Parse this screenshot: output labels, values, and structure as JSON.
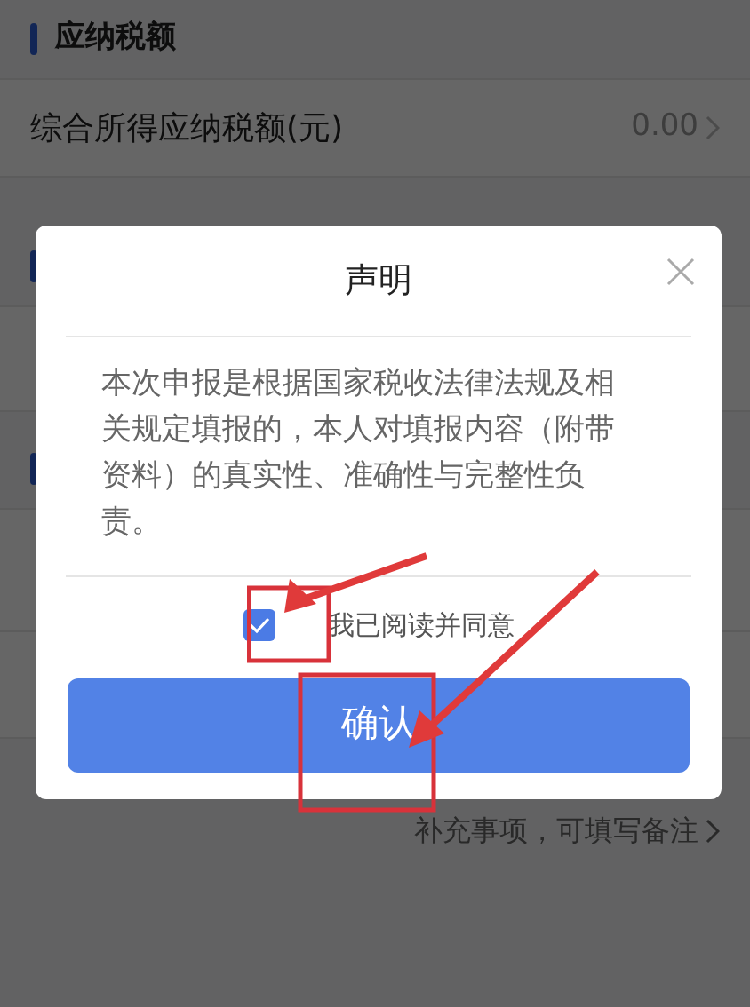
{
  "background": {
    "section_title": "应纳税额",
    "row": {
      "label": "综合所得应纳税额(元)",
      "value": "0.00"
    },
    "note": "补充事项，可填写备注"
  },
  "dialog": {
    "title": "声明",
    "body": "本次申报是根据国家税收法律法规及相关规定填报的，本人对填报内容（附带资料）的真实性、准确性与完整性负责。",
    "agree": {
      "label": "我已阅读并同意",
      "checked": true
    },
    "confirm_button": "确认"
  }
}
